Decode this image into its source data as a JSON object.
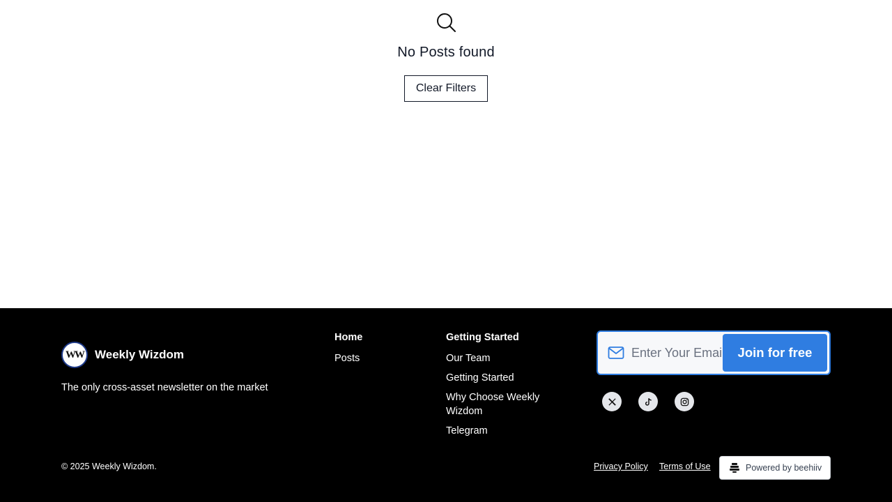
{
  "empty_state": {
    "title": "No Posts found",
    "clear_filters_label": "Clear Filters"
  },
  "footer": {
    "brand_name": "Weekly Wizdom",
    "logo_text": "WW",
    "tagline": "The only cross-asset newsletter on the market",
    "nav_columns": [
      {
        "heading": "Home",
        "links": [
          "Posts"
        ]
      },
      {
        "heading": "Getting Started",
        "links": [
          "Our Team",
          "Getting Started",
          "Why Choose Weekly Wizdom",
          "Telegram"
        ]
      }
    ],
    "subscribe": {
      "placeholder": "Enter Your Email",
      "button_label": "Join for free"
    },
    "socials": [
      {
        "icon": "x-twitter-icon"
      },
      {
        "icon": "tiktok-icon"
      },
      {
        "icon": "instagram-icon"
      }
    ],
    "copyright": "© 2025 Weekly Wizdom.",
    "privacy_label": "Privacy Policy",
    "terms_label": "Terms of Use",
    "powered_by": "Powered by beehiiv"
  },
  "colors": {
    "accent_blue": "#2f7de1",
    "footer_bg": "#000000",
    "text_dark": "#111827"
  }
}
